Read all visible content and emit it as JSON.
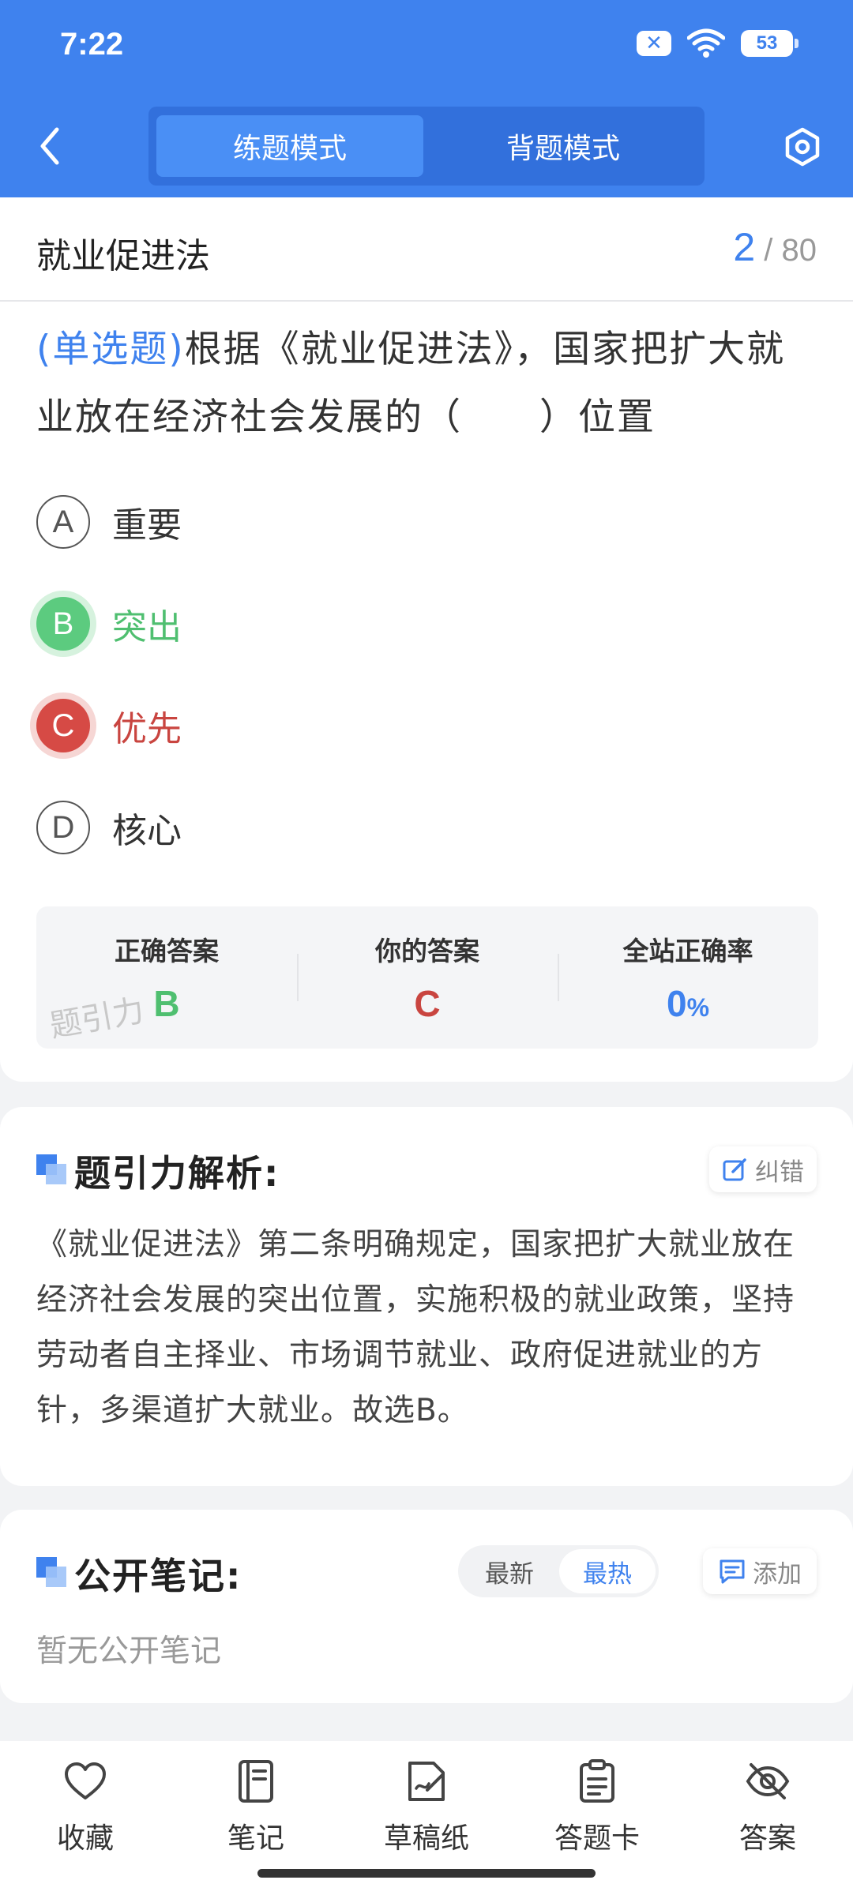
{
  "status_bar": {
    "time": "7:22",
    "battery": "53"
  },
  "header": {
    "modes": [
      "练题模式",
      "背题模式"
    ],
    "active_mode": 0
  },
  "subject": {
    "title": "就业促进法",
    "current": "2",
    "separator": "/",
    "total": "80"
  },
  "question": {
    "type_label": "(单选题)",
    "text": "根据《就业促进法》，国家把扩大就业放在经济社会发展的（　　）位置",
    "options": [
      {
        "key": "A",
        "text": "重要",
        "state": "normal"
      },
      {
        "key": "B",
        "text": "突出",
        "state": "correct"
      },
      {
        "key": "C",
        "text": "优先",
        "state": "wrong"
      },
      {
        "key": "D",
        "text": "核心",
        "state": "normal"
      }
    ]
  },
  "answer_summary": {
    "correct_label": "正确答案",
    "correct_value": "B",
    "yours_label": "你的答案",
    "yours_value": "C",
    "rate_label": "全站正确率",
    "rate_value": "0",
    "rate_unit": "%",
    "watermark": "题引力"
  },
  "analysis": {
    "title": "题引力解析:",
    "report_button": "纠错",
    "text": "《就业促进法》第二条明确规定，国家把扩大就业放在经济社会发展的突出位置，实施积极的就业政策，坚持劳动者自主择业、市场调节就业、政府促进就业的方针，多渠道扩大就业。故选B。"
  },
  "notes": {
    "title": "公开笔记:",
    "sort_options": [
      "最新",
      "最热"
    ],
    "active_sort": 1,
    "add_button": "添加",
    "empty_text": "暂无公开笔记"
  },
  "bottom_nav": [
    {
      "label": "收藏",
      "icon": "heart-icon"
    },
    {
      "label": "笔记",
      "icon": "notebook-icon"
    },
    {
      "label": "草稿纸",
      "icon": "draft-paper-icon"
    },
    {
      "label": "答题卡",
      "icon": "answer-sheet-icon"
    },
    {
      "label": "答案",
      "icon": "eye-off-icon"
    }
  ],
  "colors": {
    "primary": "#3f82ee",
    "correct": "#5ccb7f",
    "wrong": "#d64a45",
    "background": "#f2f3f5"
  }
}
